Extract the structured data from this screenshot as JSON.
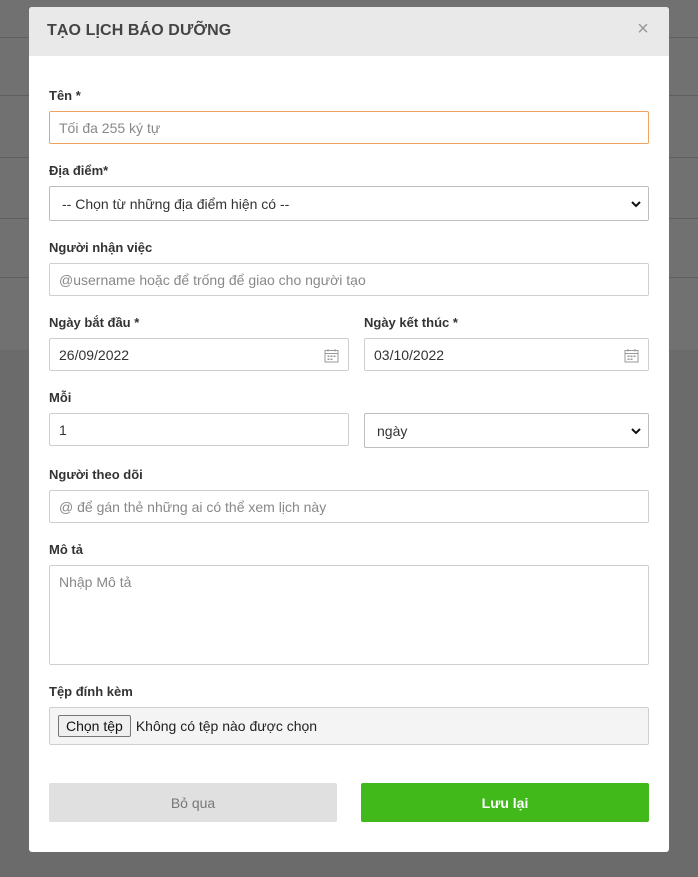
{
  "modal": {
    "title": "TẠO LỊCH BÁO DƯỠNG",
    "close_glyph": "×"
  },
  "form": {
    "name": {
      "label": "Tên *",
      "placeholder": "Tối đa 255 ký tự"
    },
    "location": {
      "label": "Địa điểm*",
      "selected": "-- Chọn từ những địa điểm hiện có --"
    },
    "assignee": {
      "label": "Người nhận việc",
      "placeholder": "@username hoặc để trống để giao cho người tạo"
    },
    "start_date": {
      "label": "Ngày bắt đầu *",
      "value": "26/09/2022"
    },
    "end_date": {
      "label": "Ngày kết thúc *",
      "value": "03/10/2022"
    },
    "repeat": {
      "label": "Mỗi",
      "value": "1",
      "unit_selected": "ngày"
    },
    "followers": {
      "label": "Người theo dõi",
      "placeholder": "@ để gán thẻ những ai có thể xem lịch này"
    },
    "description": {
      "label": "Mô tả",
      "placeholder": "Nhập Mô tả"
    },
    "attachment": {
      "label": "Tệp đính kèm",
      "button_label": "Chọn tệp",
      "status": "Không có tệp nào được chọn"
    }
  },
  "actions": {
    "cancel_label": "Bỏ qua",
    "save_label": "Lưu lại"
  },
  "colors": {
    "save_button": "#41b91b",
    "cancel_button": "#e0e0e0",
    "focused_border": "#f0a35c",
    "header_bg": "#e9e9e9",
    "overlay": "#6b6b6b"
  }
}
